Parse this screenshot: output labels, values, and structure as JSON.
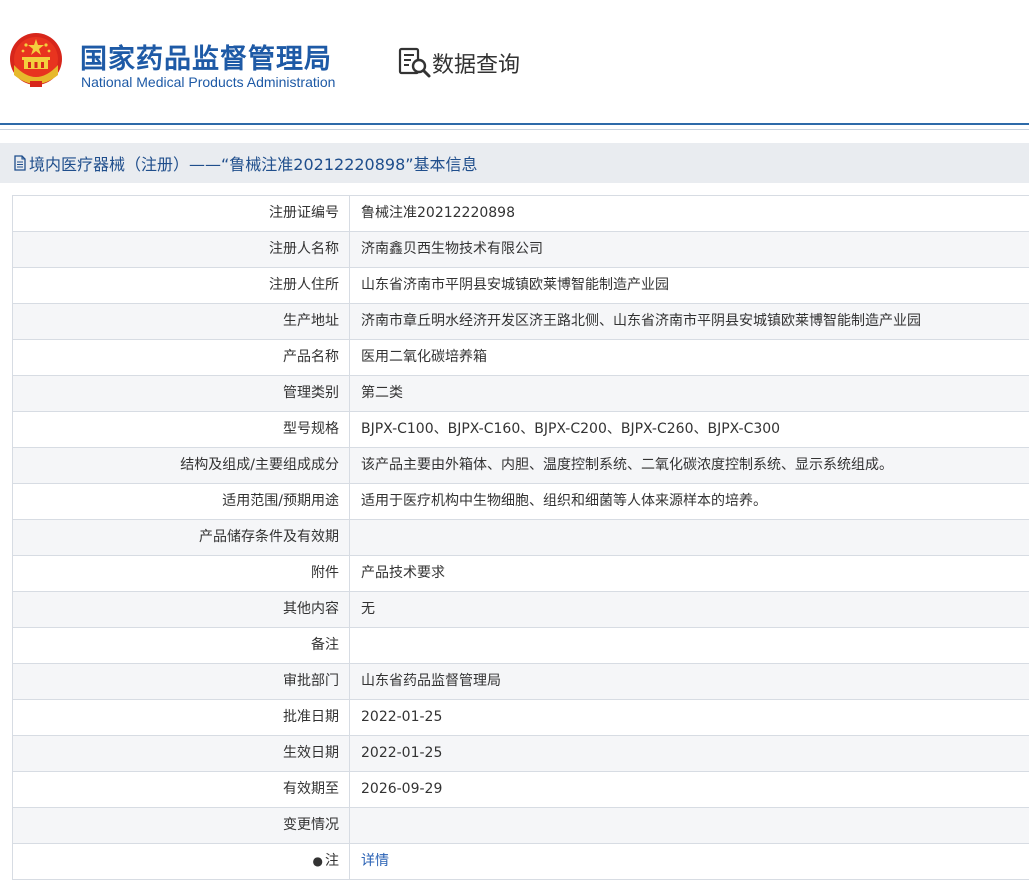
{
  "header": {
    "title_cn": "国家药品监督管理局",
    "title_en": "National Medical Products Administration",
    "query_label": "数据查询",
    "emblem_icon": "national-emblem-icon",
    "query_icon": "data-search-icon"
  },
  "section": {
    "title": "境内医疗器械（注册）——“鲁械注准20212220898”基本信息",
    "icon": "document-icon"
  },
  "rows": [
    {
      "label": "注册证编号",
      "value": "鲁械注准20212220898"
    },
    {
      "label": "注册人名称",
      "value": "济南鑫贝西生物技术有限公司"
    },
    {
      "label": "注册人住所",
      "value": "山东省济南市平阴县安城镇欧莱博智能制造产业园"
    },
    {
      "label": "生产地址",
      "value": "济南市章丘明水经济开发区济王路北侧、山东省济南市平阴县安城镇欧莱博智能制造产业园"
    },
    {
      "label": "产品名称",
      "value": "医用二氧化碳培养箱"
    },
    {
      "label": "管理类别",
      "value": "第二类"
    },
    {
      "label": "型号规格",
      "value": "BJPX-C100、BJPX-C160、BJPX-C200、BJPX-C260、BJPX-C300"
    },
    {
      "label": "结构及组成/主要组成成分",
      "value": "该产品主要由外箱体、内胆、温度控制系统、二氧化碳浓度控制系统、显示系统组成。"
    },
    {
      "label": "适用范围/预期用途",
      "value": "适用于医疗机构中生物细胞、组织和细菌等人体来源样本的培养。"
    },
    {
      "label": "产品储存条件及有效期",
      "value": ""
    },
    {
      "label": "附件",
      "value": "产品技术要求"
    },
    {
      "label": "其他内容",
      "value": "无"
    },
    {
      "label": "备注",
      "value": ""
    },
    {
      "label": "审批部门",
      "value": "山东省药品监督管理局"
    },
    {
      "label": "批准日期",
      "value": "2022-01-25"
    },
    {
      "label": "生效日期",
      "value": "2022-01-25"
    },
    {
      "label": "有效期至",
      "value": "2026-09-29"
    },
    {
      "label": "变更情况",
      "value": ""
    },
    {
      "label": "注",
      "value": "详情"
    }
  ],
  "colors": {
    "brand_blue": "#1e5aa6",
    "link_blue": "#2a62b5",
    "bar_bg": "#e9ecf0"
  }
}
